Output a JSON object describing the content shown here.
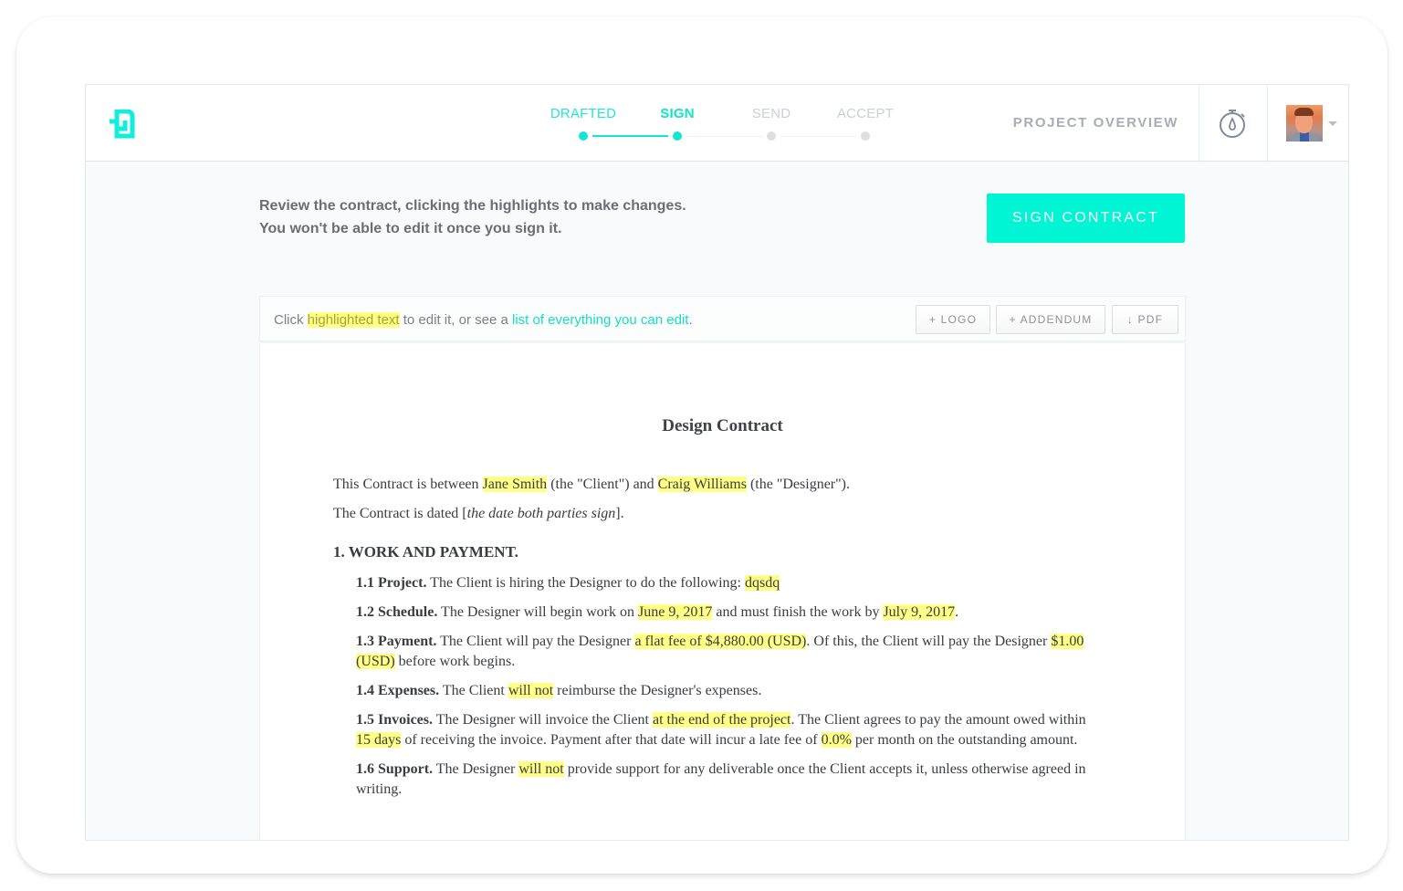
{
  "header": {
    "logo_name": "Bonsai logo",
    "steps": [
      {
        "label": "DRAFTED",
        "state": "done"
      },
      {
        "label": "SIGN",
        "state": "active"
      },
      {
        "label": "SEND",
        "state": "todo"
      },
      {
        "label": "ACCEPT",
        "state": "todo"
      }
    ],
    "project_overview": "PROJECT OVERVIEW",
    "timer_icon": "stopwatch-icon",
    "avatar_icon": "user-avatar",
    "menu_icon": "caret-down-icon"
  },
  "intro": {
    "line1": "Review the contract, clicking the highlights to make changes.",
    "line2": "You won't be able to edit it once you sign it.",
    "sign_button": "SIGN CONTRACT"
  },
  "toolbar": {
    "text_before": "Click ",
    "highlight_text": "highlighted text",
    "text_middle": " to edit it, or see a ",
    "link_text": "list of everything you can edit",
    "text_after": ".",
    "buttons": {
      "logo": "+ LOGO",
      "addendum": "+ ADDENDUM",
      "pdf": "↓ PDF"
    }
  },
  "document": {
    "title": "Design Contract",
    "intro": {
      "p1_a": "This Contract is between ",
      "client": "Jane Smith",
      "p1_b": " (the \"Client\") and ",
      "designer": "Craig Williams",
      "p1_c": " (the \"Designer\").",
      "p2_a": "The Contract is dated [",
      "p2_italic": "the date both parties sign",
      "p2_b": "]."
    },
    "section1_title": "1. WORK AND PAYMENT.",
    "clauses": {
      "c11": {
        "label": "1.1 Project.",
        "a": " The Client is hiring the Designer to do the following: ",
        "hl1": "dqsdq"
      },
      "c12": {
        "label": "1.2 Schedule.",
        "a": " The Designer will begin work on ",
        "hl1": "June 9, 2017",
        "b": " and must finish the work by ",
        "hl2": "July 9, 2017",
        "c": "."
      },
      "c13": {
        "label": "1.3 Payment.",
        "a": " The Client will pay the Designer ",
        "hl1": "a flat fee of $4,880.00 (USD)",
        "b": ". Of this, the Client will pay the Designer ",
        "hl2": "$1.00 (USD)",
        "c": " before work begins."
      },
      "c14": {
        "label": "1.4 Expenses.",
        "a": " The Client ",
        "hl1": "will not",
        "b": " reimburse the Designer's expenses."
      },
      "c15": {
        "label": "1.5 Invoices.",
        "a": " The Designer will invoice the Client ",
        "hl1": "at the end of the project",
        "b": ". The Client agrees to pay the amount owed within ",
        "hl2": "15 days",
        "c": " of receiving the invoice. Payment after that date will incur a late fee of ",
        "hl3": "0.0%",
        "d": " per month on the outstanding amount."
      },
      "c16": {
        "label": "1.6 Support.",
        "a": " The Designer ",
        "hl1": "will not",
        "b": " provide support for any deliverable once the Client accepts it, unless otherwise agreed in writing."
      }
    }
  },
  "colors": {
    "accent": "#00f5d4",
    "highlight": "#ffff85",
    "step_done": "#14e6d4",
    "step_todo": "#dedfe0"
  }
}
